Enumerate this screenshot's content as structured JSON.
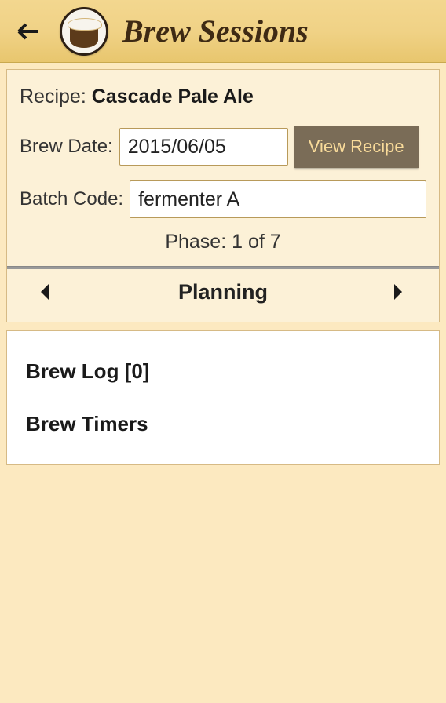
{
  "header": {
    "title": "Brew Sessions"
  },
  "recipe": {
    "label": "Recipe:",
    "name": "Cascade Pale Ale"
  },
  "brew_date": {
    "label": "Brew Date:",
    "value": "2015/06/05"
  },
  "view_recipe_label": "View Recipe",
  "batch_code": {
    "label": "Batch Code:",
    "value": "fermenter A"
  },
  "phase": {
    "label": "Phase: 1 of 7",
    "name": "Planning"
  },
  "list": {
    "brew_log": "Brew Log [0]",
    "brew_timers": "Brew Timers"
  }
}
